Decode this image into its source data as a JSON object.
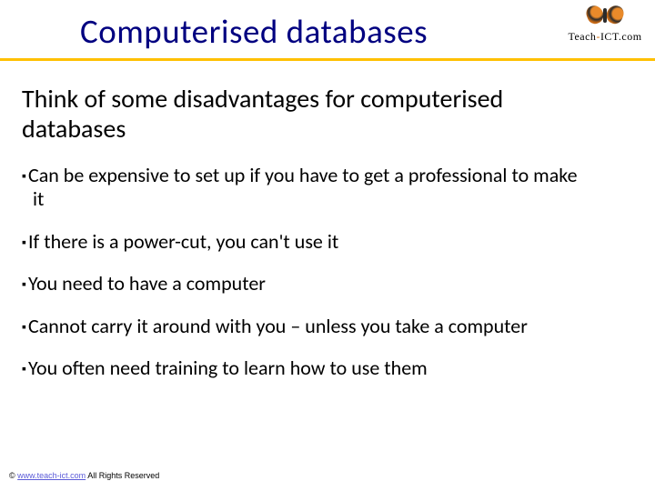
{
  "header": {
    "title": "Computerised databases",
    "logo_text_a": "Teach",
    "logo_text_hy": "-",
    "logo_text_b": "ICT.com"
  },
  "content": {
    "subtitle": "Think of some disadvantages for computerised databases",
    "bullets": [
      "Can be expensive to set up if you have to get a professional to make it",
      "If there is a power-cut, you can't use it",
      "You need to have a computer",
      "Cannot carry it around with you – unless you take a computer",
      "You often need training to learn how to use them"
    ]
  },
  "footer": {
    "copyright": "©",
    "link_text": "www.teach-ict.com",
    "rights": "  All Rights Reserved"
  }
}
